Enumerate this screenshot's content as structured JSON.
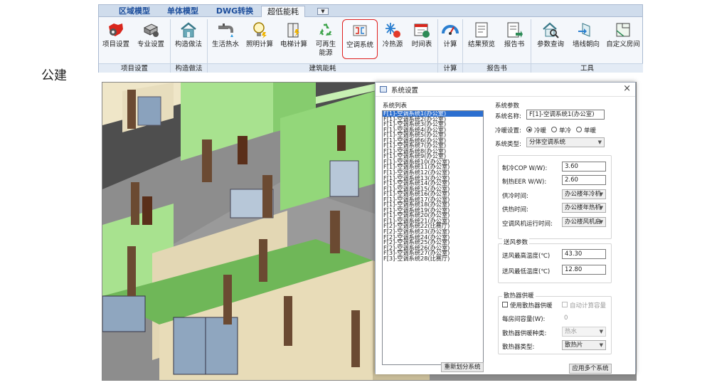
{
  "ribbon": {
    "tabs": [
      "区域模型",
      "单体模型",
      "DWG转换",
      "超低能耗"
    ],
    "more_tab": "▼",
    "buttons": [
      {
        "label": "项目设置",
        "icon": "project-settings-icon"
      },
      {
        "label": "专业设置",
        "icon": "discipline-settings-icon"
      },
      {
        "label": "构造做法",
        "icon": "construction-method-icon"
      },
      {
        "label": "生活热水",
        "icon": "domestic-hot-water-icon"
      },
      {
        "label": "照明计算",
        "icon": "lighting-calc-icon"
      },
      {
        "label": "电梯计算",
        "icon": "elevator-calc-icon"
      },
      {
        "label": "可再生\n能源",
        "icon": "renewable-energy-icon"
      },
      {
        "label": "空调系统",
        "icon": "hvac-system-icon"
      },
      {
        "label": "冷热源",
        "icon": "heat-cold-source-icon"
      },
      {
        "label": "时间表",
        "icon": "schedule-icon"
      },
      {
        "label": "计算",
        "icon": "calculate-gauge-icon"
      },
      {
        "label": "结果预览",
        "icon": "result-preview-icon"
      },
      {
        "label": "报告书",
        "icon": "report-icon"
      },
      {
        "label": "参数查询",
        "icon": "parameter-query-icon"
      },
      {
        "label": "墙线朝向",
        "icon": "wall-orientation-icon"
      },
      {
        "label": "自定义房间",
        "icon": "custom-room-icon"
      }
    ],
    "groups": [
      "项目设置",
      "构造做法",
      "建筑能耗",
      "计算",
      "报告书",
      "工具"
    ]
  },
  "side_label": "公建",
  "dialog": {
    "title": "系统设置",
    "close": "×",
    "list_title": "系统列表",
    "systems": [
      "F[1]-空调系统1(办公室)",
      "F[1]-空调系统2(办公室)",
      "F[1]-空调系统3(办公室)",
      "F[1]-空调系统4(办公室)",
      "F[1]-空调系统5(办公室)",
      "F[1]-空调系统6(办公室)",
      "F[1]-空调系统7(办公室)",
      "F[1]-空调系统8(办公室)",
      "F[1]-空调系统9(办公室)",
      "F[1]-空调系统10(办公室)",
      "F[1]-空调系统11(办公室)",
      "F[1]-空调系统12(办公室)",
      "F[1]-空调系统13(办公室)",
      "F[1]-空调系统14(办公室)",
      "F[1]-空调系统15(办公室)",
      "F[1]-空调系统16(办公室)",
      "F[1]-空调系统17(办公室)",
      "F[1]-空调系统18(办公室)",
      "F[1]-空调系统19(办公室)",
      "F[1]-空调系统20(办公室)",
      "F[1]-空调系统21(办公室)",
      "F[2]-空调系统22(比赛厅)",
      "F[2]-空调系统23(办公室)",
      "F[2]-空调系统24(办公室)",
      "F[2]-空调系统25(办公室)",
      "F[2]-空调系统26(办公室)",
      "F[3]-空调系统27(办公室)",
      "F[3]-空调系统28(比赛厅)"
    ],
    "regroup_button": "重新划分系统",
    "params_title": "系统参数",
    "name_label": "系统名称:",
    "name_value": "F[1]-空调系统1(办公室)",
    "mode_label": "冷暖设置:",
    "mode_options": [
      "冷暖",
      "单冷",
      "单暖"
    ],
    "type_label": "系统类型:",
    "type_value": "分体空调系统",
    "cop_label": "制冷COP W/W):",
    "cop_value": "3.60",
    "eer_label": "制热EER W/W):",
    "eer_value": "2.60",
    "cool_time_label": "供冷时间:",
    "cool_time_value": "办公楼年冷机",
    "heat_time_label": "供热时间:",
    "heat_time_value": "办公楼年热机",
    "fan_time_label": "空调风机运行时间:",
    "fan_time_value": "办公楼风机启",
    "supply_title": "送风参数",
    "max_temp_label": "送风最高温度(℃)",
    "max_temp_value": "43.30",
    "min_temp_label": "送风最低温度(℃)",
    "min_temp_value": "12.80",
    "radiator_title": "散热器供暖",
    "use_radiator_label": "使用散热器供暖",
    "auto_calc_label": "自动计算容量",
    "room_cap_label": "每房间容量(W):",
    "room_cap_value": "0",
    "radiator_heat_label": "散热器供暖种类:",
    "radiator_heat_value": "热水",
    "radiator_type_label": "散热器类型:",
    "radiator_type_value": "散热片",
    "apply_button": "应用多个系统"
  }
}
